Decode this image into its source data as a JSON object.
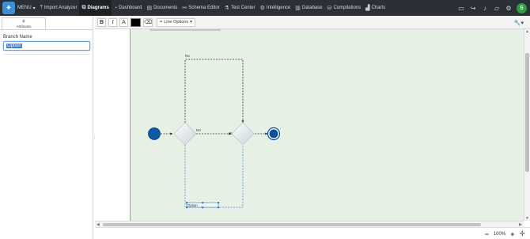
{
  "nav": {
    "menu_label": "MENU",
    "items": [
      {
        "label": "Import Analyzer",
        "icon": "upload-icon"
      },
      {
        "label": "Diagrams",
        "icon": "diagram-icon",
        "active": true
      },
      {
        "label": "Dashboard",
        "icon": "dashboard-icon"
      },
      {
        "label": "Documents",
        "icon": "documents-icon"
      },
      {
        "label": "Schema Editor",
        "icon": "schema-icon"
      },
      {
        "label": "Test Center",
        "icon": "flask-icon"
      },
      {
        "label": "Intelligence",
        "icon": "intelligence-icon"
      },
      {
        "label": "Database",
        "icon": "database-icon"
      },
      {
        "label": "Compilations",
        "icon": "compilations-icon"
      },
      {
        "label": "Charts",
        "icon": "charts-icon"
      }
    ],
    "right_icons": [
      "chat-icon",
      "share-icon",
      "bell-icon",
      "folder-icon",
      "gear-icon"
    ],
    "avatar_initial": "S",
    "colors": {
      "bar": "#2b3036",
      "avatar": "#2e9e44",
      "logo": "#3a8fd9"
    }
  },
  "left_panel": {
    "tab_label": "Attributes",
    "field_label": "Branch Name",
    "field_value": "Option"
  },
  "toolbar": {
    "bold": "B",
    "italic": "I",
    "font": "A",
    "eraser_icon": "eraser-icon",
    "line_options": "Line Options",
    "wrench_icon": "wrench-icon"
  },
  "diagram": {
    "label_no_top": "No",
    "label_no_mid": "No",
    "label_br": "Br",
    "selected_label": "Option",
    "colors": {
      "canvas": "#e6f0e4",
      "start": "#0d5aa7",
      "end": "#0d4f99",
      "selection": "#3d7fd6"
    }
  },
  "zoom": {
    "minus": "−",
    "level": "100%",
    "plus": "+",
    "fit": "✛"
  }
}
